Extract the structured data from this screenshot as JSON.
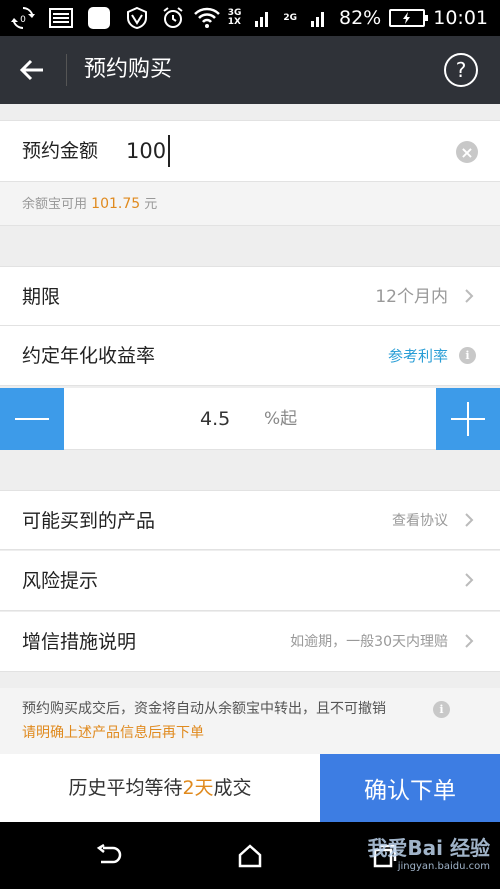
{
  "status_bar": {
    "battery_percent": "82%",
    "time": "10:01",
    "net_top": "3G",
    "net_bottom": "1X",
    "net_second": "2G"
  },
  "header": {
    "title": "预约购买"
  },
  "amount": {
    "label": "预约金额",
    "value": "100"
  },
  "available": {
    "prefix": "余额宝可用",
    "amount": "101.75",
    "suffix": "元"
  },
  "term": {
    "label": "期限",
    "value": "12个月内"
  },
  "rate": {
    "label": "约定年化收益率",
    "reference_link": "参考利率",
    "value": "4.5",
    "unit": "%起"
  },
  "products": {
    "label": "可能买到的产品",
    "action": "查看协议"
  },
  "risk": {
    "label": "风险提示"
  },
  "credit": {
    "label": "增信措施说明",
    "value": "如逾期，一般30天内理赔"
  },
  "notice": {
    "line1": "预约购买成交后，资金将自动从余额宝中转出，且不可撤销",
    "line2": "请明确上述产品信息后再下单"
  },
  "bottom": {
    "wait_prefix": "历史平均等待",
    "wait_days": "2天",
    "wait_suffix": "成交",
    "confirm_label": "确认下单"
  },
  "watermark": {
    "text": "我爱Bai 经验",
    "url": "jingyan.baidu.com"
  },
  "colors": {
    "accent_blue": "#3d9be9",
    "confirm_blue": "#3d7de3",
    "highlight_orange": "#e08a1e",
    "link_blue": "#2a9ed6",
    "header_bg": "#2f3238"
  }
}
